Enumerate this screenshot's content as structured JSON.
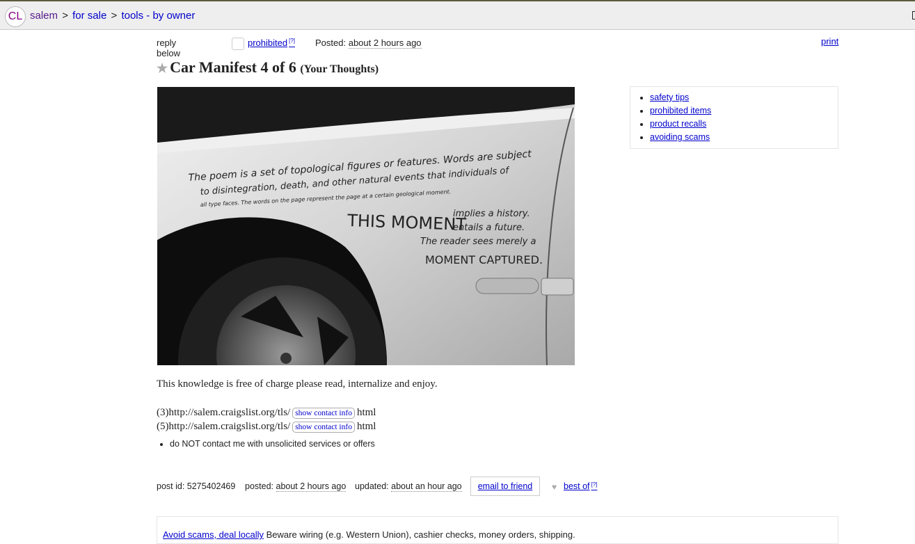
{
  "header": {
    "logo": "CL",
    "breadcrumbs": [
      {
        "label": "salem"
      },
      {
        "label": "for sale"
      },
      {
        "label": "tools - by owner"
      }
    ],
    "separator": ">"
  },
  "postinginfo": {
    "reply_label": "reply below",
    "flag_label": "prohibited",
    "flag_help": "[?]",
    "posted_label": "Posted:",
    "posted_value": "about 2 hours ago",
    "print_label": "print"
  },
  "title": {
    "main": "Car Manifest 4 of 6",
    "sub": "(Your Thoughts)"
  },
  "photo": {
    "line1": "The poem is a set of topological figures or features. Words are subject",
    "line2": "to disintegration, death, and other natural events that individuals of",
    "line3": "all type faces. The words on the page represent the page at a certain geological moment.",
    "big": "THIS MOMENT",
    "r1": "implies a history.",
    "r2": "entails a future.",
    "r3": "The reader sees merely a",
    "r4": "MOMENT CAPTURED."
  },
  "safety": {
    "items": [
      "safety tips",
      "prohibited items",
      "product recalls",
      "avoiding scams"
    ]
  },
  "body": {
    "text": "This knowledge is free of charge please read, internalize and enjoy.",
    "links": [
      {
        "prefix": "(3)http://salem.craigslist.org/tls/",
        "button": "show contact info",
        "suffix": "html"
      },
      {
        "prefix": "(5)http://salem.craigslist.org/tls/",
        "button": "show contact info",
        "suffix": "html"
      }
    ],
    "notice": "do NOT contact me with unsolicited services or offers"
  },
  "footer": {
    "post_id": "post id: 5275402469",
    "posted_label": "posted:",
    "posted_value": "about 2 hours ago",
    "updated_label": "updated:",
    "updated_value": "about an hour ago",
    "email_label": "email to friend",
    "bestof_label": "best of",
    "bestof_help": "[?]"
  },
  "scam_notice": {
    "link": "Avoid scams, deal locally",
    "text": "Beware wiring (e.g. Western Union), cashier checks, money orders, shipping."
  }
}
